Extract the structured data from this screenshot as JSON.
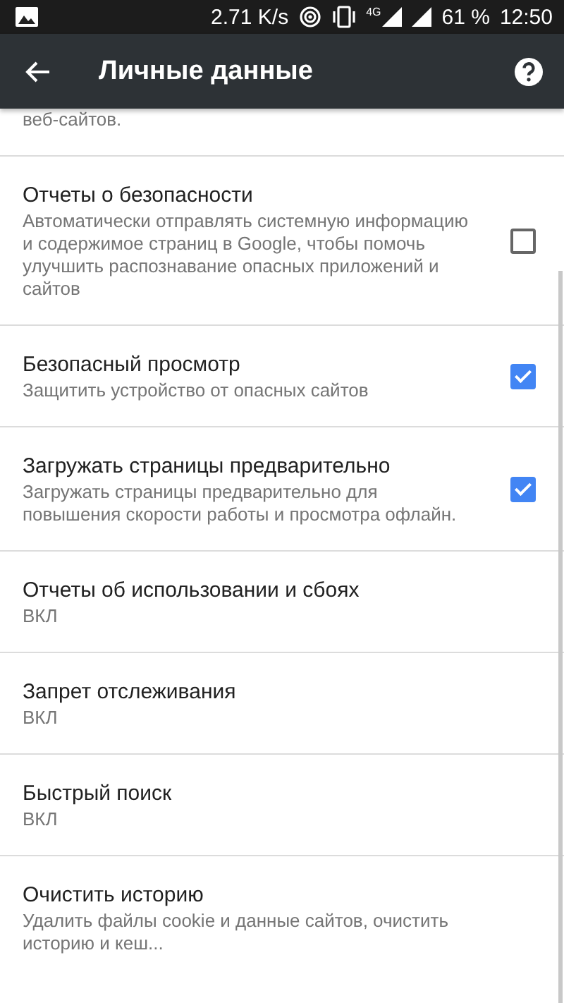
{
  "status_bar": {
    "speed": "2.71 K/s",
    "network": "4G",
    "battery": "61 %",
    "time": "12:50"
  },
  "toolbar": {
    "title": "Личные данные"
  },
  "partial_text": "веб-сайтов.",
  "settings": [
    {
      "kind": "checkbox",
      "title": "Отчеты о безопасности",
      "summary": "Автоматически отправлять системную информацию и содержимое страниц в Google, чтобы помочь улучшить распознавание опасных приложений и сайтов",
      "checked": false
    },
    {
      "kind": "checkbox",
      "title": "Безопасный просмотр",
      "summary": "Защитить устройство от опасных сайтов",
      "checked": true
    },
    {
      "kind": "checkbox",
      "title": "Загружать страницы предварительно",
      "summary": "Загружать страницы предварительно для повышения скорости работы и просмотра офлайн.",
      "checked": true
    },
    {
      "kind": "text",
      "title": "Отчеты об использовании и сбоях",
      "summary": "ВКЛ"
    },
    {
      "kind": "text",
      "title": "Запрет отслеживания",
      "summary": "ВКЛ"
    },
    {
      "kind": "text",
      "title": "Быстрый поиск",
      "summary": "ВКЛ"
    },
    {
      "kind": "text",
      "title": "Очистить историю",
      "summary": "Удалить файлы cookie и данные сайтов, очистить историю и кеш..."
    }
  ]
}
